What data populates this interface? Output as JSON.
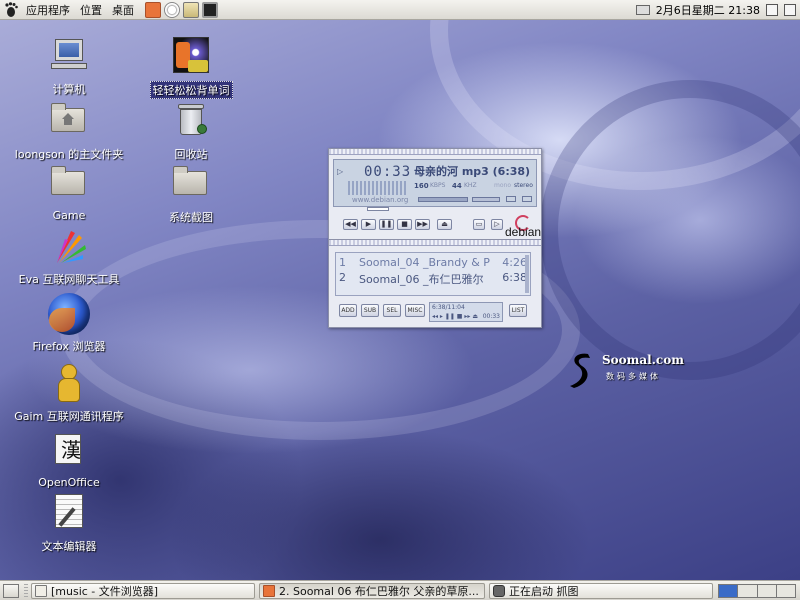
{
  "top_panel": {
    "menus": [
      "应用程序",
      "位置",
      "桌面"
    ],
    "clock": "2月6日星期二  21:38"
  },
  "desktop_icons": [
    {
      "label": "计算机"
    },
    {
      "label": "loongson 的主文件夹"
    },
    {
      "label": "Game"
    },
    {
      "label": "Eva 互联网聊天工具"
    },
    {
      "label": "Firefox 浏览器"
    },
    {
      "label": "Gaim 互联网通讯程序"
    },
    {
      "label": "OpenOffice"
    },
    {
      "label": "文本编辑器"
    },
    {
      "label": "轻轻松松背单词"
    },
    {
      "label": "回收站"
    },
    {
      "label": "系统截图"
    }
  ],
  "player": {
    "time": "00:33",
    "title": "母亲的河  mp3 (6:38)",
    "kbps": "160",
    "kbps_unit": "KBPS",
    "khz": "44",
    "khz_unit": "KHZ",
    "mono": "mono",
    "stereo": "stereo",
    "site": "www.debian.org",
    "logo_text": "debian",
    "playlist": [
      {
        "num": "1",
        "title": "Soomal_04 _Brandy & P",
        "duration": "4:26"
      },
      {
        "num": "2",
        "title": "Soomal_06 _布仁巴雅尔",
        "duration": "6:38"
      }
    ],
    "buttons": {
      "add": "ADD",
      "sub": "SUB",
      "sel": "SEL",
      "misc": "MISC",
      "list": "LIST"
    },
    "total_time": "6:38/11:04",
    "mini_time": "00:33",
    "progress": 0.08
  },
  "watermark": {
    "name": "Soomal.com",
    "tagline": "数码多媒体"
  },
  "taskbar": {
    "tasks": [
      {
        "label": "[music - 文件浏览器]"
      },
      {
        "label": "2. Soomal 06  布仁巴雅尔  父亲的草原..."
      },
      {
        "label": "正在启动  抓图"
      }
    ]
  }
}
